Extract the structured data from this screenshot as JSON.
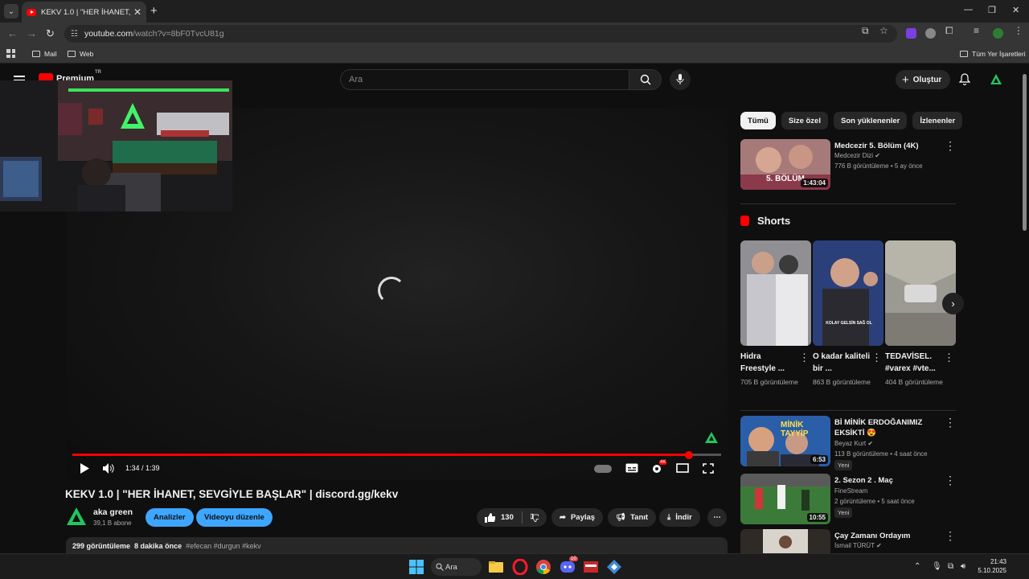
{
  "browser": {
    "tab_title": "KEKV 1.0 | \"HER İHANET, SEVGİ",
    "address_host": "youtube.com",
    "address_path": "/watch?v=8bF0TvcU81g",
    "bookmarks": [
      "Mail",
      "Web"
    ],
    "bookmarks_right": "Tüm Yer İşaretleri"
  },
  "header": {
    "logo_text": "Premium",
    "logo_badge": "TR",
    "search_placeholder": "Ara",
    "create_label": "Oluştur"
  },
  "player": {
    "time": "1:34 / 1:39",
    "progress": 0.95
  },
  "video": {
    "title": "KEKV 1.0 | \"HER İHANET, SEVGİYLE BAŞLAR\" | discord.gg/kekv",
    "channel": "aka green",
    "subscribers": "39,1 B abone",
    "analytics_label": "Analizler",
    "edit_label": "Videoyu düzenle",
    "likes": "130",
    "share_label": "Paylaş",
    "promote_label": "Tanıt",
    "download_label": "İndir",
    "views": "299 görüntüleme",
    "age": "8 dakika önce",
    "tags": "#efecan #durgun #kekv"
  },
  "sidebar": {
    "chips": [
      "Tümü",
      "Size özel",
      "Son yüklenenler",
      "İzlenenler"
    ],
    "first": {
      "title": "Medcezir 5. Bölüm (4K)",
      "channel": "Medcezir Dizi",
      "meta": "776 B görüntüleme • 5 ay önce",
      "duration": "1:43:04",
      "thumb_text": "5. BÖLÜM"
    },
    "shorts_heading": "Shorts",
    "shorts": [
      {
        "title": "Hidra Freestyle ...",
        "views": "705 B görüntüleme"
      },
      {
        "title": "O kadar kaliteli bir ...",
        "views": "863 B görüntüleme",
        "overlay": "KOLAY GELSİN SAĞ OL"
      },
      {
        "title": "TEDAVİSEL. #varex #vte...",
        "views": "404 B görüntüleme"
      }
    ],
    "videos": [
      {
        "title": "Bİ MİNİK ERDOĞANIMIZ EKSİKTİ 😍",
        "channel": "Beyaz Kurt",
        "meta": "113 B görüntüleme • 4 saat önce",
        "duration": "6:53",
        "badge": "Yeni",
        "thumb_text": "MİNİK TAYYİP"
      },
      {
        "title": "2. Sezon 2 . Maç",
        "channel": "FineStream",
        "meta": "2 görüntüleme • 5 saat önce",
        "duration": "10:55",
        "badge": "Yeni"
      },
      {
        "title": "Çay Zamanı Ordayım",
        "channel": "İsmail TÜRÜT",
        "meta": ""
      }
    ]
  },
  "taskbar": {
    "search_label": "Ara",
    "time": "21:43",
    "date": "5.10.2025",
    "chat_badge": "10"
  },
  "colors": {
    "accent_red": "#ff0000",
    "blue_button": "#3ea6ff",
    "green_logo": "#22c55e"
  }
}
